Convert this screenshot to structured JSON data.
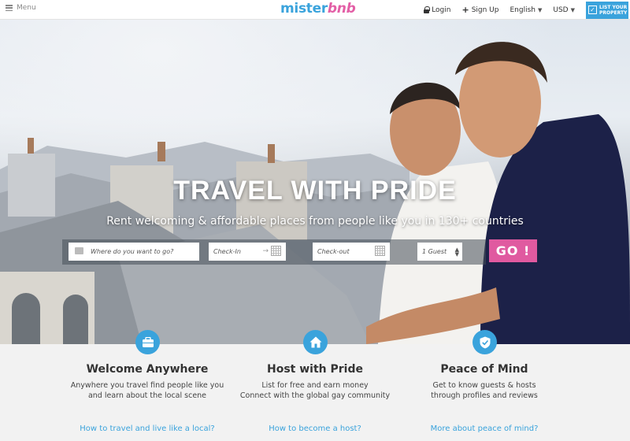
{
  "header": {
    "menu_label": "Menu",
    "logo_part1": "mister",
    "logo_part2": "bnb",
    "login": "Login",
    "signup": "Sign Up",
    "language": "English",
    "currency": "USD",
    "list_property": "LIST YOUR PROPERTY"
  },
  "hero": {
    "title": "TRAVEL WITH PRIDE",
    "subtitle": "Rent welcoming & affordable places from people like you in 130+ countries"
  },
  "search": {
    "where_placeholder": "Where do you want to go?",
    "checkin_placeholder": "Check-In",
    "checkout_placeholder": "Check-out",
    "guests_value": "1 Guest",
    "go_label": "GO !"
  },
  "features": [
    {
      "icon": "suitcase-icon",
      "title": "Welcome Anywhere",
      "desc_line1": "Anywhere you travel find people like you",
      "desc_line2": "and learn about the local scene",
      "link": "How to travel and live like a local?"
    },
    {
      "icon": "home-icon",
      "title": "Host with Pride",
      "desc_line1": "List for free and earn money",
      "desc_line2": "Connect with the global gay community",
      "link": "How to become a host?"
    },
    {
      "icon": "shield-check-icon",
      "title": "Peace of Mind",
      "desc_line1": "Get to know guests & hosts",
      "desc_line2": "through profiles and reviews",
      "link": "More about peace of mind?"
    }
  ],
  "colors": {
    "brand_blue": "#3aa3dc",
    "brand_pink": "#e05aa0"
  }
}
